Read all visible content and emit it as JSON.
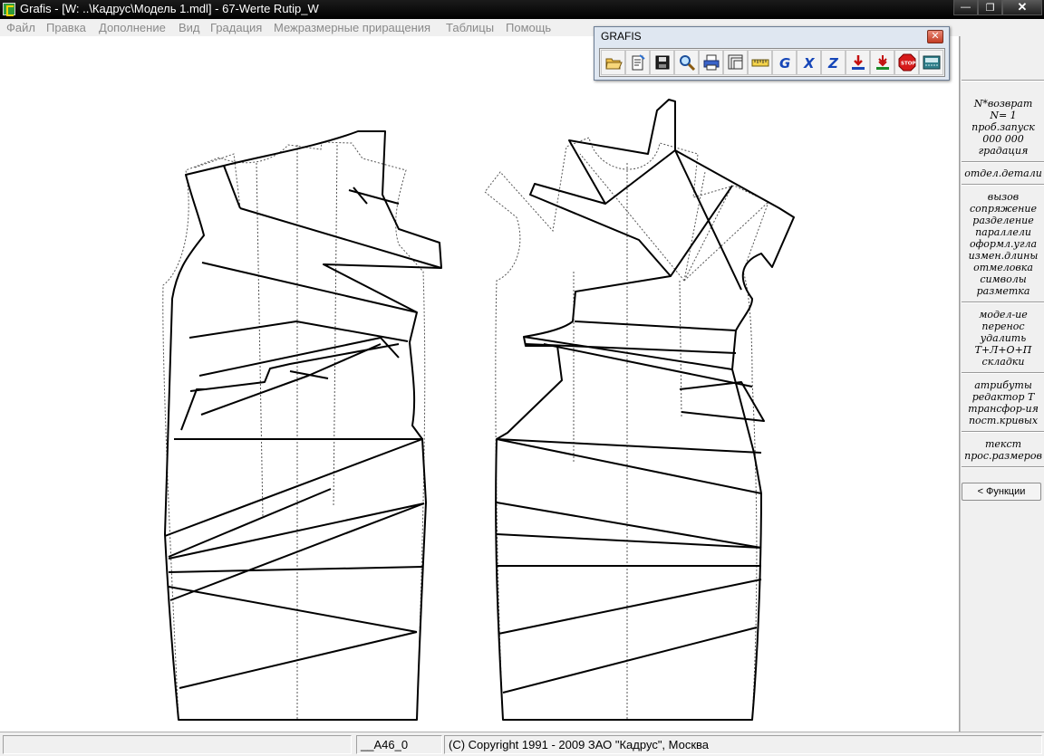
{
  "window": {
    "title": "Grafis - [W: ..\\Кадрус\\Модель 1.mdl] - 67-Werte Rutip_W"
  },
  "menu": {
    "items": [
      "Файл",
      "Правка",
      "Дополнение",
      "Вид",
      "Градация",
      "Межразмерные приращения",
      "Таблицы",
      "Помощь"
    ]
  },
  "toolbar": {
    "title": "GRAFIS",
    "buttons": [
      {
        "icon": "open-folder-icon"
      },
      {
        "icon": "edit-document-icon"
      },
      {
        "icon": "save-disk-icon"
      },
      {
        "icon": "zoom-magnifier-icon"
      },
      {
        "icon": "print-icon"
      },
      {
        "icon": "layers-icon"
      },
      {
        "icon": "ruler-measure-icon"
      },
      {
        "icon": "grafis-g-icon"
      },
      {
        "icon": "grafis-x-icon"
      },
      {
        "icon": "grafis-z-icon"
      },
      {
        "icon": "download-arrow-icon"
      },
      {
        "icon": "download-double-arrow-icon"
      },
      {
        "icon": "stop-sign-icon"
      },
      {
        "icon": "keyboard-calc-icon"
      }
    ]
  },
  "side_panel": {
    "group1": [
      "N*возврат",
      "N=  1",
      "проб.запуск",
      "000 000",
      "градация"
    ],
    "group2": [
      "отдел.детали"
    ],
    "group3": [
      "вызов",
      "сопряжение",
      "разделение",
      "параллели",
      "оформл.угла",
      "измен.длины",
      "отмеловка",
      "символы",
      "разметка"
    ],
    "group4": [
      "модел-ие",
      "перенос",
      "удалить",
      "Т+Л+О+П",
      "складки"
    ],
    "group5": [
      "атрибуты",
      "редактор Т",
      "трансфор-ия",
      "пост.кривых"
    ],
    "group6": [
      "текст",
      "прос.размеров"
    ],
    "functions_button": "< Функции"
  },
  "status": {
    "cell1": "",
    "cell2": "__A46_0",
    "cell3": "(C) Copyright 1991 - 2009 ЗАО \"Кадрус\", Москва"
  }
}
